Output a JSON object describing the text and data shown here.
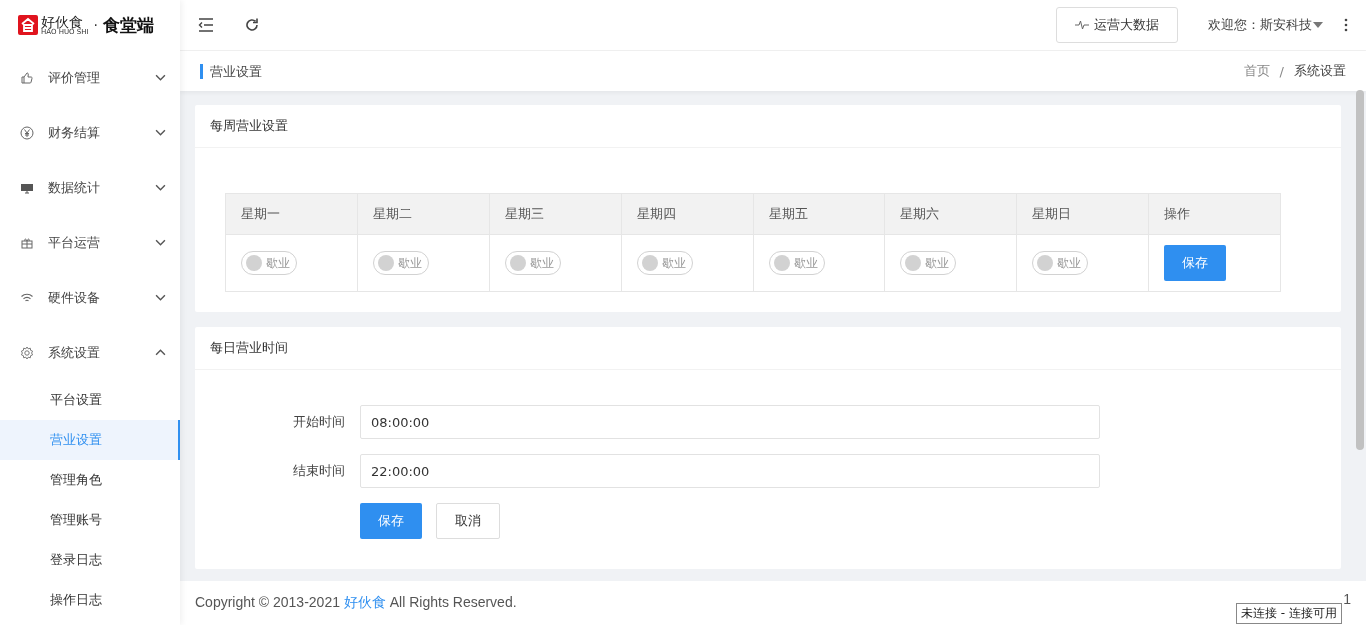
{
  "logo": {
    "brand": "好伙食",
    "pinyin": "HAO HUO SHI",
    "dot": "·",
    "product": "食堂端"
  },
  "header": {
    "data_button": "运营大数据",
    "welcome": "欢迎您：斯安科技"
  },
  "page_title": "营业设置",
  "breadcrumb": [
    "首页",
    "/",
    "系统设置"
  ],
  "sidebar": {
    "items": [
      {
        "label": "评价管理",
        "expanded": false
      },
      {
        "label": "财务结算",
        "expanded": false
      },
      {
        "label": "数据统计",
        "expanded": false
      },
      {
        "label": "平台运营",
        "expanded": false
      },
      {
        "label": "硬件设备",
        "expanded": false
      },
      {
        "label": "系统设置",
        "expanded": true,
        "children": [
          {
            "label": "平台设置",
            "selected": false
          },
          {
            "label": "营业设置",
            "selected": true
          },
          {
            "label": "管理角色",
            "selected": false
          },
          {
            "label": "管理账号",
            "selected": false
          },
          {
            "label": "登录日志",
            "selected": false
          },
          {
            "label": "操作日志",
            "selected": false
          }
        ]
      }
    ]
  },
  "weekly": {
    "title": "每周营业设置",
    "columns": [
      "星期一",
      "星期二",
      "星期三",
      "星期四",
      "星期五",
      "星期六",
      "星期日",
      "操作"
    ],
    "days": [
      {
        "on": false,
        "label": "歇业"
      },
      {
        "on": false,
        "label": "歇业"
      },
      {
        "on": false,
        "label": "歇业"
      },
      {
        "on": false,
        "label": "歇业"
      },
      {
        "on": false,
        "label": "歇业"
      },
      {
        "on": false,
        "label": "歇业"
      },
      {
        "on": false,
        "label": "歇业"
      }
    ],
    "save": "保存"
  },
  "daily": {
    "title": "每日营业时间",
    "fields": [
      {
        "label": "开始时间",
        "value": "08:00:00"
      },
      {
        "label": "结束时间",
        "value": "22:00:00"
      }
    ],
    "save": "保存",
    "cancel": "取消"
  },
  "footer": {
    "before": "Copyright © 2013-2021",
    "link": "好伙食",
    "after": "All Rights Reserved.",
    "version": "1"
  },
  "tooltip": "未连接 - 连接可用"
}
